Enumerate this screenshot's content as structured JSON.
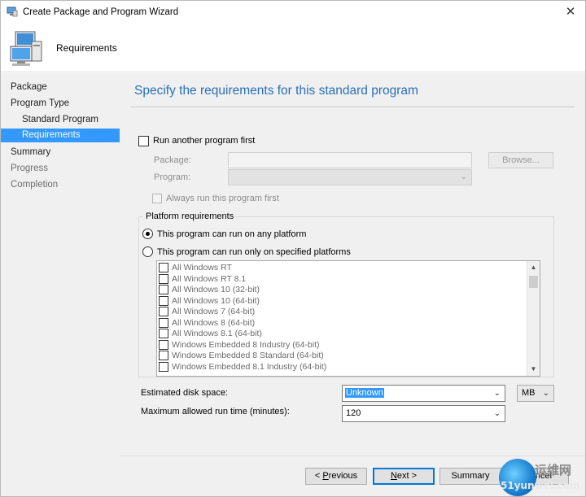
{
  "window": {
    "title": "Create Package and Program Wizard",
    "close_glyph": "✕"
  },
  "header": {
    "title": "Requirements",
    "icon": "computer-wizard-icon"
  },
  "sidebar": {
    "items": [
      {
        "label": "Package",
        "state": "normal"
      },
      {
        "label": "Program Type",
        "state": "normal"
      },
      {
        "label": "Standard Program",
        "state": "normal"
      },
      {
        "label": "Requirements",
        "state": "active"
      },
      {
        "label": "Summary",
        "state": "normal"
      },
      {
        "label": "Progress",
        "state": "dim"
      },
      {
        "label": "Completion",
        "state": "dim"
      }
    ]
  },
  "main": {
    "heading": "Specify the requirements for this standard program",
    "run_another": {
      "label": "Run another program first",
      "checked": false,
      "package_label": "Package:",
      "package_value": "",
      "browse_label": "Browse...",
      "program_label": "Program:",
      "program_value": "",
      "always_run_label": "Always run this program first",
      "always_run_checked": false
    },
    "platform": {
      "group_title": "Platform requirements",
      "option_any": "This program can run on any platform",
      "option_specified": "This program can run only on specified platforms",
      "selected": "any",
      "platforms": [
        "All Windows RT",
        "All Windows RT 8.1",
        "All Windows 10 (32-bit)",
        "All Windows 10 (64-bit)",
        "All Windows 7 (64-bit)",
        "All Windows 8 (64-bit)",
        "All Windows 8.1 (64-bit)",
        "Windows Embedded 8 Industry (64-bit)",
        "Windows Embedded 8 Standard (64-bit)",
        "Windows Embedded 8.1 Industry (64-bit)"
      ]
    },
    "disk_space": {
      "label": "Estimated disk space:",
      "value": "Unknown",
      "unit": "MB"
    },
    "max_runtime": {
      "label": "Maximum allowed run time (minutes):",
      "value": "120"
    }
  },
  "footer": {
    "previous_prefix": "< ",
    "previous_accel": "P",
    "previous_rest": "revious",
    "next_accel": "N",
    "next_rest": "ext >",
    "summary_label": "Summary",
    "cancel_label": "Cancel"
  },
  "watermark": {
    "text": "运维网",
    "sub": "51yunwei.com"
  },
  "colors": {
    "accent": "#3399ff",
    "heading": "#2b6fb8",
    "panel": "#f0f0f0",
    "default_button_border": "#0078d7"
  }
}
